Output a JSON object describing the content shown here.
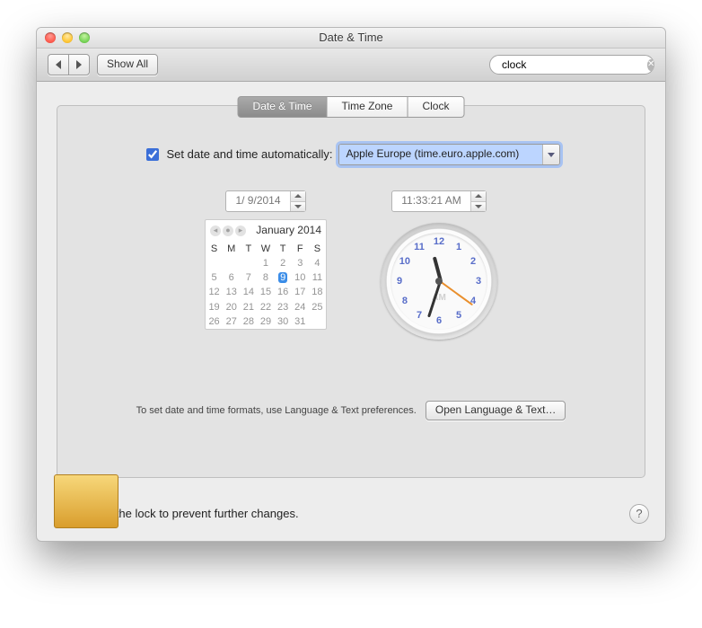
{
  "window": {
    "title": "Date & Time"
  },
  "toolbar": {
    "show_all_label": "Show All",
    "search_value": "clock"
  },
  "tabs": {
    "datetime": "Date & Time",
    "timezone": "Time Zone",
    "clock": "Clock"
  },
  "auto": {
    "label": "Set date and time automatically:",
    "server": "Apple Europe (time.euro.apple.com)"
  },
  "date": {
    "value": "1/ 9/2014",
    "month_label": "January 2014",
    "weekdays": [
      "S",
      "M",
      "T",
      "W",
      "T",
      "F",
      "S"
    ],
    "weeks": [
      [
        "",
        "",
        "",
        "1",
        "2",
        "3",
        "4"
      ],
      [
        "5",
        "6",
        "7",
        "8",
        "9",
        "10",
        "11"
      ],
      [
        "12",
        "13",
        "14",
        "15",
        "16",
        "17",
        "18"
      ],
      [
        "19",
        "20",
        "21",
        "22",
        "23",
        "24",
        "25"
      ],
      [
        "26",
        "27",
        "28",
        "29",
        "30",
        "31",
        ""
      ]
    ],
    "selected_day": "9"
  },
  "time": {
    "value": "11:33:21 AM",
    "ampm": "AM",
    "clock_numbers": [
      "12",
      "1",
      "2",
      "3",
      "4",
      "5",
      "6",
      "7",
      "8",
      "9",
      "10",
      "11"
    ]
  },
  "footer": {
    "hint": "To set date and time formats, use Language & Text preferences.",
    "open_btn": "Open Language & Text…"
  },
  "lock": {
    "hint": "Click the lock to prevent further changes."
  }
}
